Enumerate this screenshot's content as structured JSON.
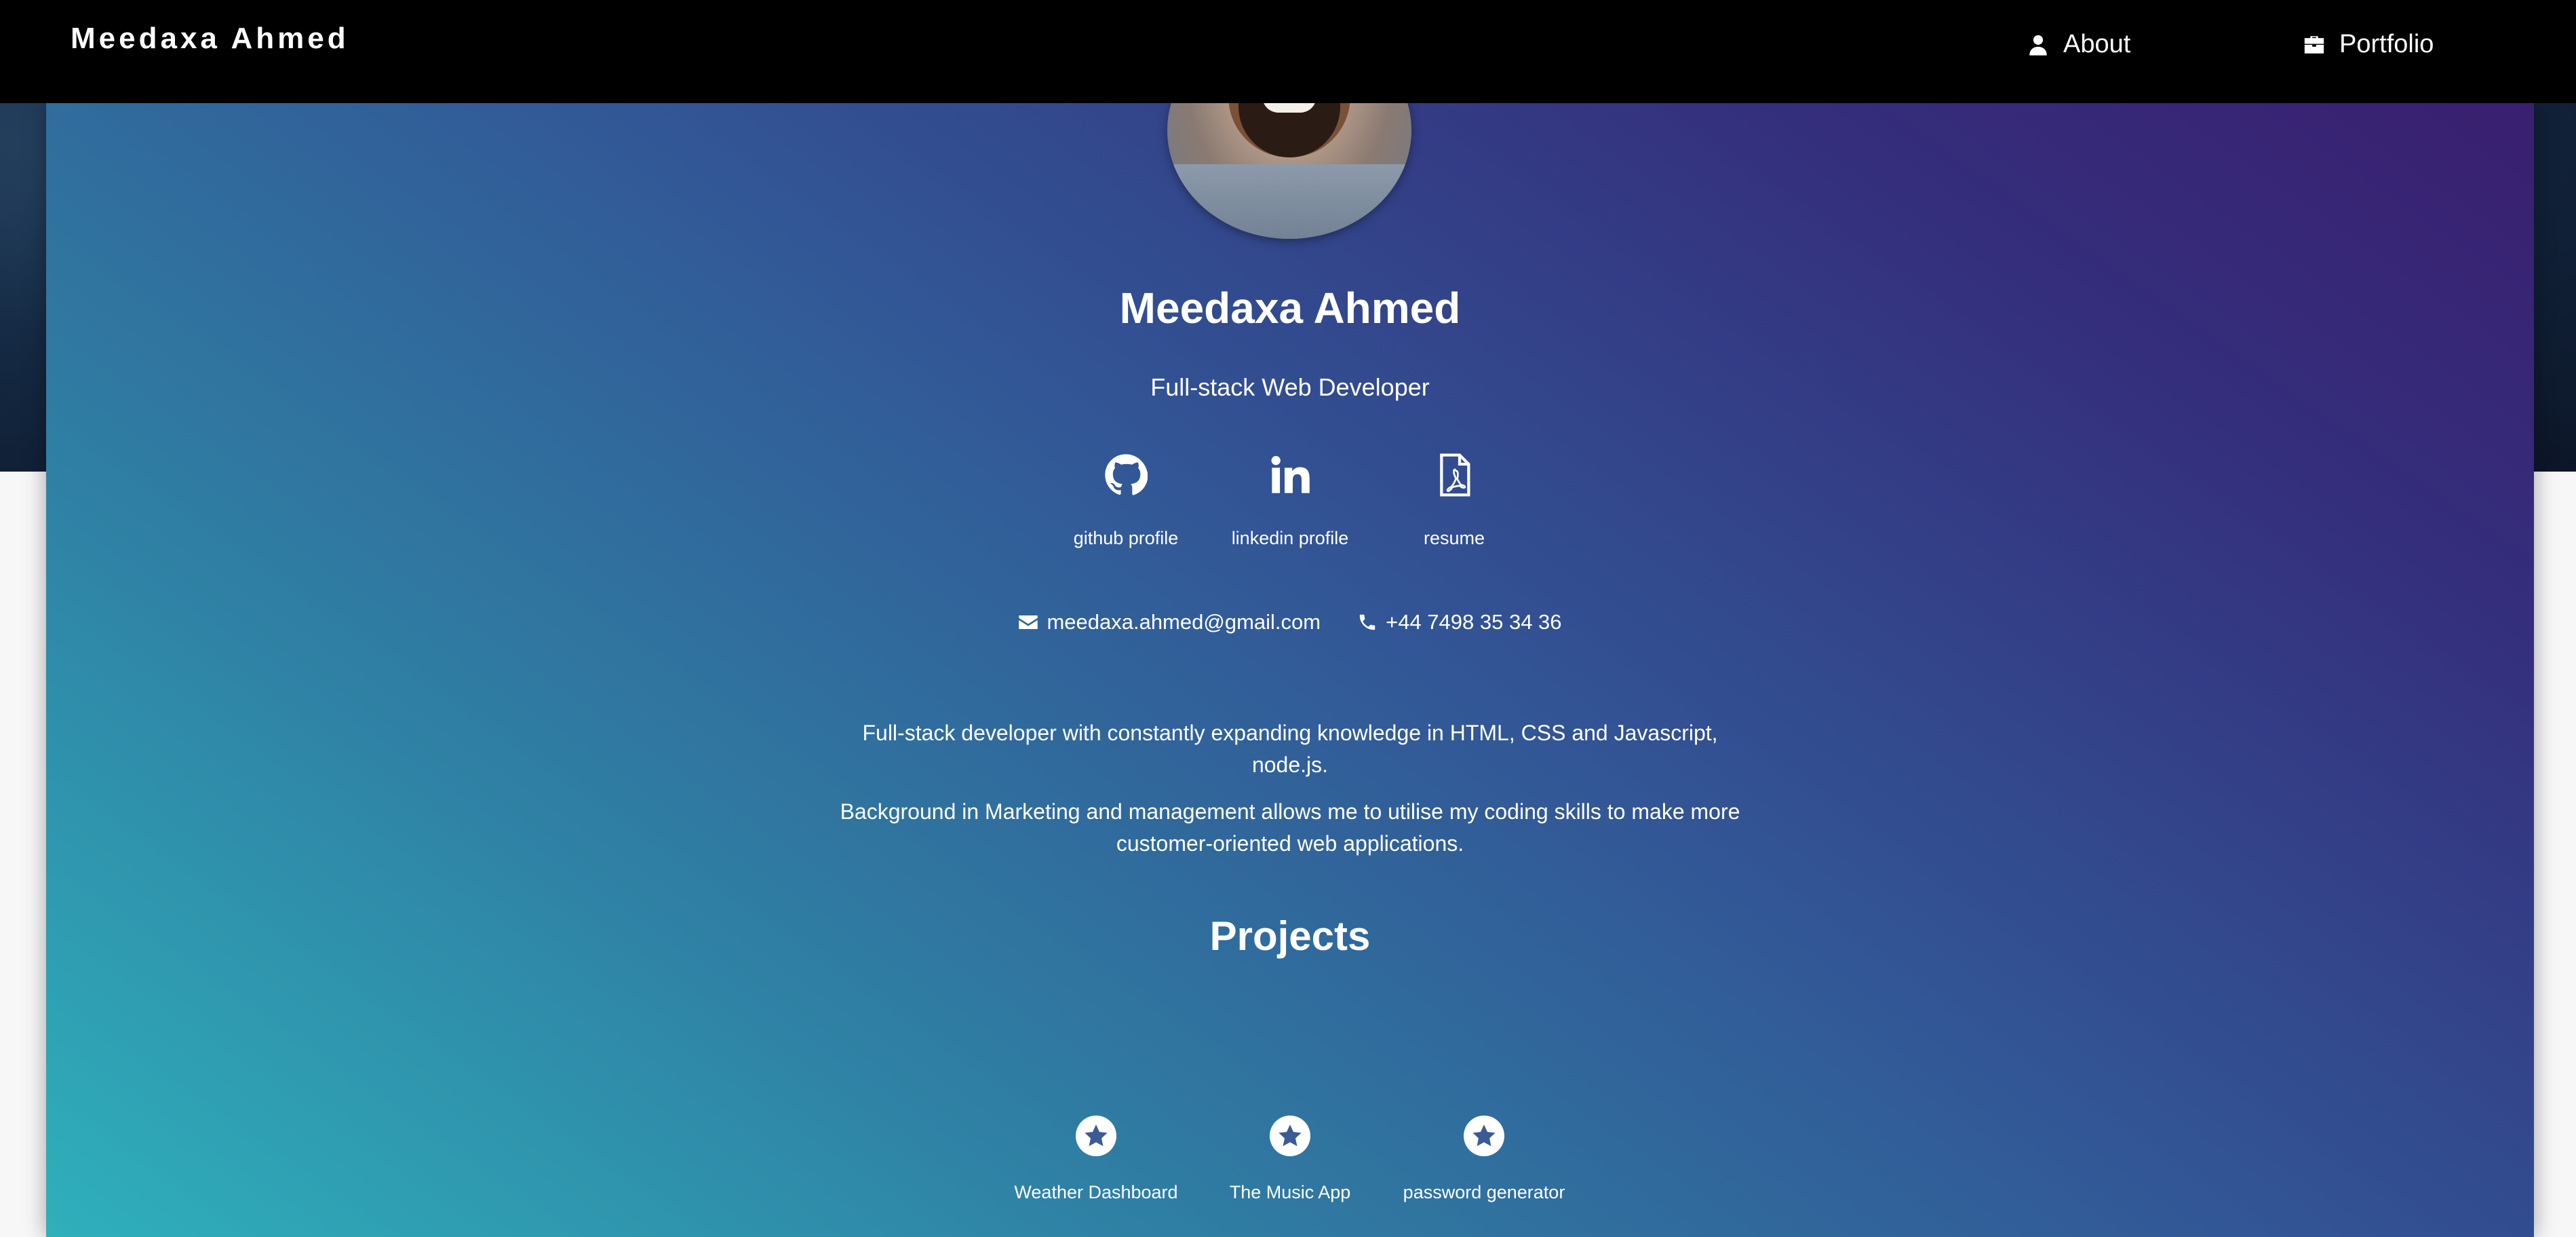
{
  "navbar": {
    "brand": "Meedaxa Ahmed",
    "items": [
      {
        "label": "About",
        "icon": "user-icon"
      },
      {
        "label": "Portfolio",
        "icon": "briefcase-icon"
      }
    ]
  },
  "profile": {
    "name": "Meedaxa Ahmed",
    "role": "Full-stack Web Developer",
    "links": [
      {
        "label": "github profile",
        "icon": "github-icon"
      },
      {
        "label": "linkedin profile",
        "icon": "linkedin-icon"
      },
      {
        "label": "resume",
        "icon": "pdf-file-icon"
      }
    ],
    "email": "meedaxa.ahmed@gmail.com",
    "phone": "+44 7498 35 34 36"
  },
  "about": {
    "paragraph1": "Full-stack developer with constantly expanding knowledge in HTML, CSS and Javascript, node.js.",
    "paragraph2": "Background in Marketing and management allows me to utilise my coding skills to make more customer-oriented web applications."
  },
  "projects": {
    "title": "Projects",
    "items": [
      {
        "label": "Weather Dashboard",
        "icon": "star-icon"
      },
      {
        "label": "The Music App",
        "icon": "star-icon"
      },
      {
        "label": "password generator",
        "icon": "star-icon"
      }
    ]
  },
  "colors": {
    "navbar": "#000000",
    "gradient_start": "#2fb0bb",
    "gradient_end": "#3a1f6f"
  }
}
